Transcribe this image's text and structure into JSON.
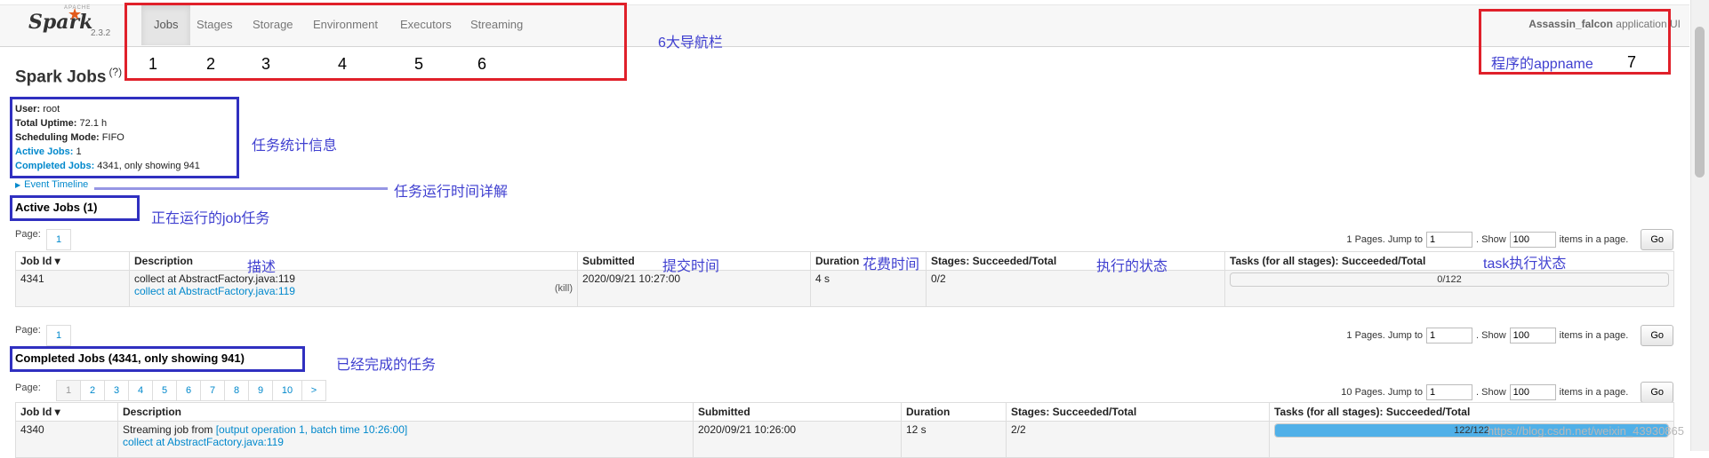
{
  "navbar": {
    "logo_text": "Spark",
    "logo_small": "APACHE",
    "version": "2.3.2",
    "tabs": [
      "Jobs",
      "Stages",
      "Storage",
      "Environment",
      "Executors",
      "Streaming"
    ],
    "app_name": "Assassin_falcon",
    "app_suffix": "application UI"
  },
  "page": {
    "title": "Spark Jobs",
    "help": "(?)"
  },
  "summary": {
    "user_label": "User:",
    "user": "root",
    "uptime_label": "Total Uptime:",
    "uptime": "72.1 h",
    "mode_label": "Scheduling Mode:",
    "mode": "FIFO",
    "active_label": "Active Jobs:",
    "active": "1",
    "completed_label": "Completed Jobs:",
    "completed": "4341, only showing 941"
  },
  "event_timeline": "Event Timeline",
  "active_jobs": {
    "title": "Active Jobs (1)",
    "page_label": "Page:",
    "page": "1",
    "jump_text": "1 Pages. Jump to",
    "jump_value": "1",
    "show_text": ". Show",
    "show_value": "100",
    "items_text": "items in a page.",
    "go": "Go",
    "headers": [
      "Job Id ▾",
      "Description",
      "Submitted",
      "Duration",
      "Stages: Succeeded/Total",
      "Tasks (for all stages): Succeeded/Total"
    ],
    "row": {
      "id": "4341",
      "desc1": "collect at AbstractFactory.java:119",
      "desc2": "collect at AbstractFactory.java:119",
      "kill": "(kill)",
      "submitted": "2020/09/21 10:27:00",
      "duration": "4 s",
      "stages": "0/2",
      "tasks": "0/122",
      "tasks_fraction": 0
    },
    "bottom_page_label": "Page:",
    "bottom_page": "1",
    "bottom_jump_text": "1 Pages. Jump to",
    "bottom_jump_value": "1",
    "bottom_show_value": "100"
  },
  "completed_jobs": {
    "title": "Completed Jobs (4341, only showing 941)",
    "page_label": "Page:",
    "pages": [
      "1",
      "2",
      "3",
      "4",
      "5",
      "6",
      "7",
      "8",
      "9",
      "10",
      ">"
    ],
    "jump_text": "10 Pages. Jump to",
    "jump_value": "1",
    "show_value": "100",
    "headers": [
      "Job Id ▾",
      "Description",
      "Submitted",
      "Duration",
      "Stages: Succeeded/Total",
      "Tasks (for all stages): Succeeded/Total"
    ],
    "row": {
      "id": "4340",
      "desc_prefix": "Streaming job from",
      "desc_link": "[output operation 1, batch time 10:26:00]",
      "desc2": "collect at AbstractFactory.java:119",
      "submitted": "2020/09/21 10:26:00",
      "duration": "12 s",
      "stages": "2/2",
      "tasks": "122/122",
      "tasks_fraction": 1
    }
  },
  "annotations": {
    "nav_label": "6大导航栏",
    "nav_numbers": [
      "1",
      "2",
      "3",
      "4",
      "5",
      "6"
    ],
    "appname_label": "程序的appname",
    "appname_number": "7",
    "stats_label": "任务统计信息",
    "timeline_label": "任务运行时间详解",
    "active_label": "正在运行的job任务",
    "desc_label": "描述",
    "submitted_label": "提交时间",
    "duration_label": "花费时间",
    "stages_label": "执行的状态",
    "tasks_label": "task执行状态",
    "completed_label": "已经完成的任务"
  },
  "watermark": "https://blog.csdn.net/weixin_43930865"
}
